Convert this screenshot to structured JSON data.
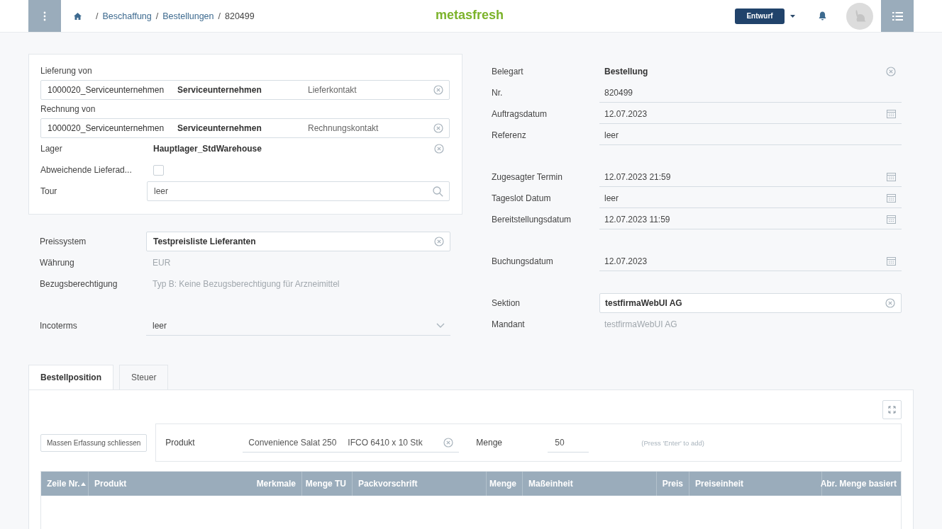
{
  "header": {
    "breadcrumbs": [
      {
        "separator": "/",
        "label": "Beschaffung"
      },
      {
        "separator": "/",
        "label": "Bestellungen"
      },
      {
        "separator": "/",
        "label": "820499"
      }
    ],
    "logo": "metasfresh",
    "status": "Entwurf"
  },
  "left_card": [
    {
      "label": "Lieferung von",
      "kind": "address",
      "parts": [
        "1000020_Serviceunternehmen",
        "Serviceunternehmen",
        "Lieferkontakt"
      ],
      "clearable": true
    },
    {
      "label": "Rechnung von",
      "kind": "address",
      "parts": [
        "1000020_Serviceunternehmen",
        "Serviceunternehmen",
        "Rechnungskontakt"
      ],
      "clearable": true
    },
    {
      "label": "Lager",
      "kind": "text",
      "value": "Hauptlager_StdWarehouse",
      "clearable": true
    },
    {
      "label": "Abweichende Lieferad...",
      "kind": "checkbox",
      "checked": false
    },
    {
      "label": "Tour",
      "kind": "search",
      "value": "leer"
    }
  ],
  "left_groups": [
    [
      {
        "label": "Preissystem",
        "kind": "lookup",
        "value": "Testpreisliste Lieferanten",
        "clearable": true
      },
      {
        "label": "Währung",
        "kind": "readonly",
        "value": "EUR"
      },
      {
        "label": "Bezugsberechtigung",
        "kind": "readonly",
        "value": "Typ B: Keine Bezugsberechtigung für Arzneimittel"
      }
    ],
    [
      {
        "label": "Incoterms",
        "kind": "dropdown",
        "value": "leer"
      }
    ]
  ],
  "right_groups": [
    [
      {
        "label": "Belegart",
        "kind": "text",
        "value": "Bestellung",
        "clearable": true
      },
      {
        "label": "Nr.",
        "kind": "underlined",
        "value": "820499"
      },
      {
        "label": "Auftragsdatum",
        "kind": "date",
        "value": "12.07.2023"
      },
      {
        "label": "Referenz",
        "kind": "underlined",
        "value": "leer"
      }
    ],
    [
      {
        "label": "Zugesagter Termin",
        "kind": "date",
        "value": "12.07.2023 21:59"
      },
      {
        "label": "Tageslot Datum",
        "kind": "date",
        "value": "leer"
      },
      {
        "label": "Bereitstellungsdatum",
        "kind": "date",
        "value": "12.07.2023 11:59"
      }
    ],
    [
      {
        "label": "Buchungsdatum",
        "kind": "date",
        "value": "12.07.2023"
      }
    ],
    [
      {
        "label": "Sektion",
        "kind": "lookup",
        "value": "testfirmaWebUI AG",
        "clearable": true
      },
      {
        "label": "Mandant",
        "kind": "readonly",
        "value": "testfirmaWebUI AG"
      }
    ]
  ],
  "tabs": [
    {
      "label": "Bestellposition",
      "selected": true
    },
    {
      "label": "Steuer",
      "selected": false
    }
  ],
  "quick_entry": {
    "button": "Massen Erfassung schliessen",
    "product_label": "Produkt",
    "product_parts": [
      "Convenience Salat 250",
      "IFCO 6410 x 10 Stk"
    ],
    "qty_label": "Menge",
    "qty": "50",
    "hint": "(Press 'Enter' to add)"
  },
  "table": {
    "columns": [
      {
        "label": "Zeile Nr.",
        "sorted": true
      },
      {
        "label": "Produkt",
        "sorted": false
      },
      {
        "label": "Merkmale",
        "sorted": false
      },
      {
        "label": "Menge TU",
        "sorted": false
      },
      {
        "label": "Packvorschrift",
        "sorted": false
      },
      {
        "label": "Menge",
        "sorted": false
      },
      {
        "label": "Maßeinheit",
        "sorted": false
      },
      {
        "label": "Preis",
        "sorted": false
      },
      {
        "label": "Preiseinheit",
        "sorted": false
      },
      {
        "label": "Abr. Menge basiert",
        "sorted": false
      }
    ]
  }
}
